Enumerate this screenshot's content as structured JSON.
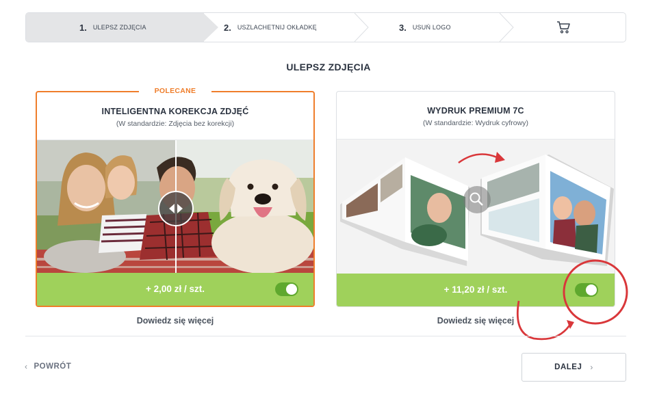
{
  "stepper": {
    "steps": [
      {
        "num": "1.",
        "label": "ULEPSZ ZDJĘCIA"
      },
      {
        "num": "2.",
        "label": "USZLACHETNIJ OKŁADKĘ"
      },
      {
        "num": "3.",
        "label": "USUŃ LOGO"
      }
    ],
    "cart_icon": "cart-icon"
  },
  "page": {
    "title": "ULEPSZ ZDJĘCIA"
  },
  "options": [
    {
      "badge": "POLECANE",
      "title": "INTELIGENTNA KOREKCJA ZDJĘĆ",
      "subtitle": "(W standardzie: Zdjęcia bez korekcji)",
      "price": "+ 2,00 zł / szt.",
      "enabled": true,
      "learn_more": "Dowiedz się więcej"
    },
    {
      "title": "WYDRUK PREMIUM 7C",
      "subtitle": "(W standardzie: Wydruk cyfrowy)",
      "price": "+ 11,20 zł / szt.",
      "enabled": true,
      "learn_more": "Dowiedz się więcej"
    }
  ],
  "nav": {
    "back": "POWRÓT",
    "next": "DALEJ"
  },
  "colors": {
    "accent_orange": "#ef7d2a",
    "price_bar": "#9fd15b",
    "toggle_on": "#5fa82e",
    "highlight_red": "#d9373a"
  }
}
